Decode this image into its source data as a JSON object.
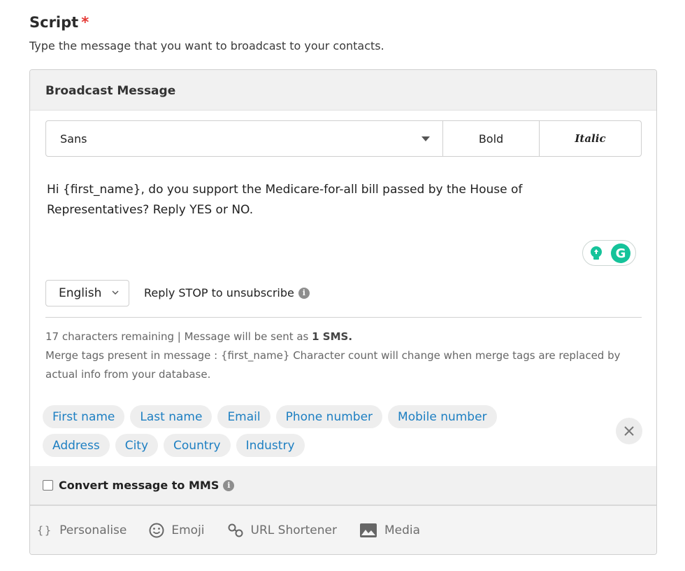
{
  "section": {
    "title": "Script",
    "required_mark": "*",
    "subtitle": "Type the message that you want to broadcast to your contacts."
  },
  "card": {
    "title": "Broadcast Message",
    "toolbar": {
      "font_value": "Sans",
      "bold_label": "Bold",
      "italic_label": "Italic"
    },
    "message_text": "Hi {first_name}, do you support the Medicare-for-all bill passed by the House of Representatives? Reply YES or NO.",
    "language": "English",
    "reply_stop": "Reply STOP to unsubscribe",
    "info": {
      "remaining": "17 characters remaining | Message will be sent as ",
      "sms_count": "1 SMS.",
      "merge_note": "Merge tags present in message : {first_name} Character count will change when merge tags are replaced by actual info from your database."
    },
    "tags_row1": [
      "First name",
      "Last name",
      "Email",
      "Phone number",
      "Mobile number"
    ],
    "tags_row2": [
      "Address",
      "City",
      "Country",
      "Industry"
    ],
    "mms_label": "Convert message to MMS",
    "bottom": {
      "personalise": "Personalise",
      "emoji": "Emoji",
      "url_shortener": "URL Shortener",
      "media": "Media"
    }
  },
  "icons": {
    "info": "info-icon",
    "grammarly": "grammarly-icon",
    "close": "close-icon",
    "emoji": "smiley-icon",
    "link": "link-icon",
    "media": "image-icon"
  },
  "colors": {
    "required": "#e53935",
    "tag_text": "#1d7fc2",
    "grammarly": "#15c39a"
  }
}
